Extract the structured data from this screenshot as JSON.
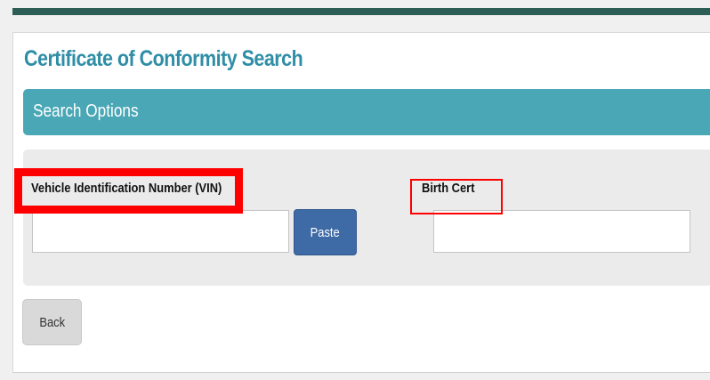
{
  "page": {
    "title": "Certificate of Conformity Search"
  },
  "search_options": {
    "header": "Search Options",
    "vin": {
      "label": "Vehicle Identification Number (VIN)",
      "value": "",
      "placeholder": ""
    },
    "paste_label": "Paste",
    "birth_cert": {
      "label": "Birth Cert",
      "value": "",
      "placeholder": ""
    }
  },
  "actions": {
    "back_label": "Back"
  },
  "annotations": {
    "highlight_color": "#ff0000"
  },
  "colors": {
    "top_bar": "#2c5e56",
    "title": "#2f8ea6",
    "section_header": "#4aa7b5",
    "paste_button": "#3e6aa6",
    "back_button": "#d9d9d9"
  }
}
